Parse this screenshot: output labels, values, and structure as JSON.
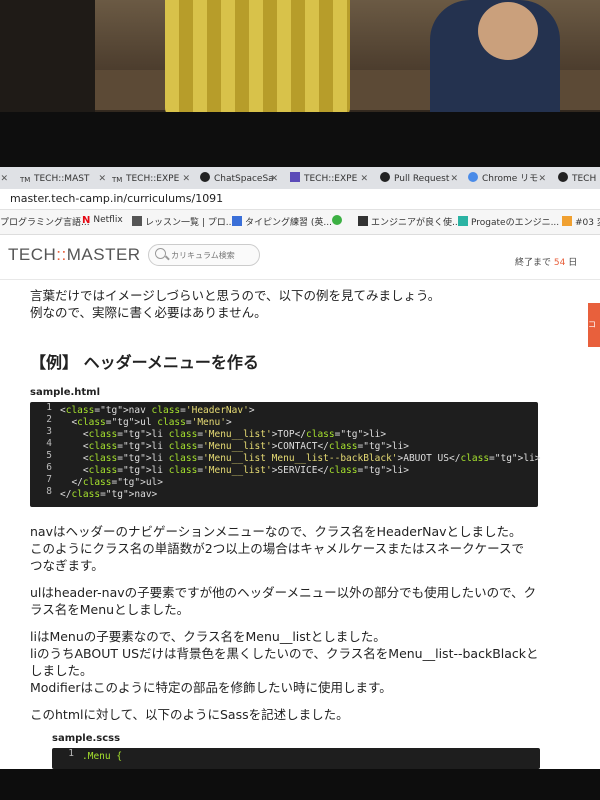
{
  "browser": {
    "tabs": [
      {
        "label": "TECH::MAST",
        "icon": "tm-icon"
      },
      {
        "label": "TECH::EXPE",
        "icon": "tm-icon"
      },
      {
        "label": "ChatSpaceSa",
        "icon": "github-icon"
      },
      {
        "label": "TECH::EXPE",
        "icon": "doc-icon"
      },
      {
        "label": "Pull Request",
        "icon": "github-icon"
      },
      {
        "label": "Chrome リモ",
        "icon": "chrome-icon"
      },
      {
        "label": "TECH",
        "icon": "github-icon"
      }
    ],
    "url": "master.tech-camp.in/curriculums/1091",
    "bookmarks": [
      {
        "label": "プログラミング言語..."
      },
      {
        "label": "Netflix"
      },
      {
        "label": "レッスン一覧 | プロ..."
      },
      {
        "label": "タイピング練習 (英..."
      },
      {
        "label": ""
      },
      {
        "label": "エンジニアが良く使..."
      },
      {
        "label": "Progateのエンジニ..."
      },
      {
        "label": "#03 変"
      }
    ]
  },
  "site": {
    "logo_left": "TECH",
    "logo_sep": "::",
    "logo_right": "MASTER",
    "search_placeholder": "カリキュラム検索",
    "progress_prefix": "終了まで",
    "progress_value": "54",
    "progress_unit": "日",
    "side_tab": "コ"
  },
  "content": {
    "intro_1": "言葉だけではイメージしづらいと思うので、以下の例を見てみましょう。",
    "intro_2": "例なので、実際に書く必要はありません。",
    "heading": "【例】 ヘッダーメニューを作る",
    "file_html": "sample.html",
    "code_lines": [
      "<nav class='HeaderNav'>",
      "  <ul class='Menu'>",
      "    <li class='Menu__list'>TOP</li>",
      "    <li class='Menu__list'>CONTACT</li>",
      "    <li class='Menu__list Menu__list--backBlack'>ABUOT US</li>",
      "    <li class='Menu__list'>SERVICE</li>",
      "  </ul>",
      "</nav>"
    ],
    "p1_a": "navはヘッダーのナビゲーションメニューなので、クラス名をHeaderNavとしました。",
    "p1_b": "このようにクラス名の単語数が2つ以上の場合はキャメルケースまたはスネークケースで",
    "p1_c": "つなぎます。",
    "p2_a": "ulはheader-navの子要素ですが他のヘッダーメニュー以外の部分でも使用したいので、ク",
    "p2_b": "ラス名をMenuとしました。",
    "p3_a": "liはMenuの子要素なので、クラス名をMenu__listとしました。",
    "p3_b": "liのうちABOUT USだけは背景色を黒くしたいので、クラス名をMenu__list--backBlackと",
    "p3_c": "しました。",
    "p3_d": "Modifierはこのように特定の部品を修飾したい時に使用します。",
    "p4": "このhtmlに対して、以下のようにSassを記述しました。",
    "file_scss": "sample.scss",
    "scss_line1": ".Menu {"
  },
  "colors": {
    "accent": "#e8603c",
    "code_bg": "#1e1e1e"
  }
}
